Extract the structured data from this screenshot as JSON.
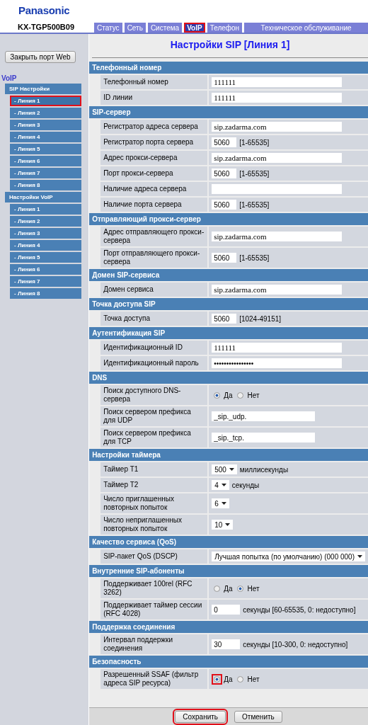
{
  "header": {
    "brand": "Panasonic",
    "model": "KX-TGP500B09"
  },
  "tabs": [
    {
      "label": "Статус",
      "selected": false,
      "highlighted": false
    },
    {
      "label": "Сеть",
      "selected": false,
      "highlighted": false
    },
    {
      "label": "Система",
      "selected": false,
      "highlighted": false
    },
    {
      "label": "VoIP",
      "selected": true,
      "highlighted": true
    },
    {
      "label": "Телефон",
      "selected": false,
      "highlighted": false
    },
    {
      "label": "Техническое обслуживание",
      "selected": false,
      "highlighted": false
    }
  ],
  "sidebar": {
    "close_button": "Закрыть порт Web",
    "heading": "VoIP",
    "groups": [
      {
        "label": "SIP Настройки",
        "items": [
          {
            "label": "- Линия 1",
            "selected": true,
            "highlighted": true
          },
          {
            "label": "- Линия 2",
            "selected": false,
            "highlighted": false
          },
          {
            "label": "- Линия 3",
            "selected": false,
            "highlighted": false
          },
          {
            "label": "- Линия 4",
            "selected": false,
            "highlighted": false
          },
          {
            "label": "- Линия 5",
            "selected": false,
            "highlighted": false
          },
          {
            "label": "- Линия 6",
            "selected": false,
            "highlighted": false
          },
          {
            "label": "- Линия 7",
            "selected": false,
            "highlighted": false
          },
          {
            "label": "- Линия 8",
            "selected": false,
            "highlighted": false
          }
        ]
      },
      {
        "label": "Настройки VoIP",
        "items": [
          {
            "label": "- Линия 1",
            "selected": false,
            "highlighted": false
          },
          {
            "label": "- Линия 2",
            "selected": false,
            "highlighted": false
          },
          {
            "label": "- Линия 3",
            "selected": false,
            "highlighted": false
          },
          {
            "label": "- Линия 4",
            "selected": false,
            "highlighted": false
          },
          {
            "label": "- Линия 5",
            "selected": false,
            "highlighted": false
          },
          {
            "label": "- Линия 6",
            "selected": false,
            "highlighted": false
          },
          {
            "label": "- Линия 7",
            "selected": false,
            "highlighted": false
          },
          {
            "label": "- Линия 8",
            "selected": false,
            "highlighted": false
          }
        ]
      }
    ]
  },
  "page_title": "Настройки SIP [Линия 1]",
  "sections": [
    {
      "title": "Телефонный номер",
      "rows": [
        {
          "kind": "text",
          "label": "Телефонный номер",
          "value": "111111"
        },
        {
          "kind": "text",
          "label": "ID линии",
          "value": "111111"
        }
      ]
    },
    {
      "title": "SIP-сервер",
      "rows": [
        {
          "kind": "text",
          "label": "Регистратор адреса сервера",
          "value": "sip.zadarma.com"
        },
        {
          "kind": "number",
          "label": "Регистратор порта сервера",
          "value": "5060",
          "unit": "[1-65535]"
        },
        {
          "kind": "text",
          "label": "Адрес прокси-сервера",
          "value": "sip.zadarma.com"
        },
        {
          "kind": "number",
          "label": "Порт прокси-сервера",
          "value": "5060",
          "unit": "[1-65535]"
        },
        {
          "kind": "text",
          "label": "Наличие адреса сервера"
        },
        {
          "kind": "number",
          "label": "Наличие порта сервера",
          "value": "5060",
          "unit": "[1-65535]"
        }
      ]
    },
    {
      "title": "Отправляющий прокси-сервер",
      "rows": [
        {
          "kind": "text",
          "label": "Адрес отправляющего прокси-сервера",
          "value": "sip.zadarma.com"
        },
        {
          "kind": "number",
          "label": "Порт отправляющего прокси-сервера",
          "value": "5060",
          "unit": "[1-65535]"
        }
      ]
    },
    {
      "title": "Домен SIP-сервиса",
      "rows": [
        {
          "kind": "text",
          "label": "Домен сервиса",
          "value": "sip.zadarma.com"
        }
      ]
    },
    {
      "title": "Точка доступа SIP",
      "rows": [
        {
          "kind": "number",
          "label": "Точка доступа",
          "value": "5060",
          "unit": "[1024-49151]"
        }
      ]
    },
    {
      "title": "Аутентификация SIP",
      "rows": [
        {
          "kind": "text",
          "label": "Идентификационный ID",
          "value": "111111"
        },
        {
          "kind": "password",
          "label": "Идентификационный пароль",
          "value": "••••••••••••••••"
        }
      ]
    },
    {
      "title": "DNS",
      "rows": [
        {
          "kind": "radio",
          "label": "Поиск доступного DNS-сервера",
          "options": [
            {
              "label": "Да",
              "selected": true,
              "highlighted": false
            },
            {
              "label": "Нет",
              "selected": false,
              "highlighted": false
            }
          ]
        },
        {
          "kind": "prefix",
          "label": "Поиск сервером префикса для UDP",
          "value": "_sip._udp."
        },
        {
          "kind": "prefix",
          "label": "Поиск сервером префикса для TCP",
          "value": "_sip._tcp."
        }
      ]
    },
    {
      "title": "Настройки таймера",
      "rows": [
        {
          "kind": "select",
          "label": "Таймер T1",
          "value": "500",
          "unit": "миллисекунды"
        },
        {
          "kind": "select",
          "label": "Таймер T2",
          "value": "4",
          "unit": "секунды"
        },
        {
          "kind": "select",
          "label": "Число приглашенных повторных попыток",
          "value": "6"
        },
        {
          "kind": "select",
          "label": "Число неприглашенных повторных попыток",
          "value": "10"
        }
      ]
    },
    {
      "title": "Качество сервиса (QoS)",
      "rows": [
        {
          "kind": "select",
          "label": "SIP-пакет QoS (DSCP)",
          "value": "Лучшая попытка (по умолчанию) (000 000)"
        }
      ]
    },
    {
      "title": "Внутренние SIP-абоненты",
      "rows": [
        {
          "kind": "radio",
          "label": "Поддерживает 100rel (RFC 3262)",
          "options": [
            {
              "label": "Да",
              "selected": false,
              "highlighted": false
            },
            {
              "label": "Нет",
              "selected": true,
              "highlighted": false
            }
          ]
        },
        {
          "kind": "number",
          "label": "Поддерживает таймер сессии (RFC 4028)",
          "value": "0",
          "unit": "секунды [60-65535, 0: недоступно]"
        }
      ]
    },
    {
      "title": "Поддержка соединения",
      "rows": [
        {
          "kind": "number",
          "label": "Интервал поддержки соединения",
          "value": "30",
          "unit": "секунды [10-300, 0: недоступно]"
        }
      ]
    },
    {
      "title": "Безопасность",
      "rows": [
        {
          "kind": "radio",
          "label": "Разрешенный SSAF (фильтр адреса SIP ресурса)",
          "options": [
            {
              "label": "Да",
              "selected": true,
              "highlighted": true
            },
            {
              "label": "Нет",
              "selected": false,
              "highlighted": false
            }
          ]
        }
      ]
    }
  ],
  "buttons": [
    {
      "label": "Сохранить",
      "highlighted": true
    },
    {
      "label": "Отменить",
      "highlighted": false
    }
  ]
}
